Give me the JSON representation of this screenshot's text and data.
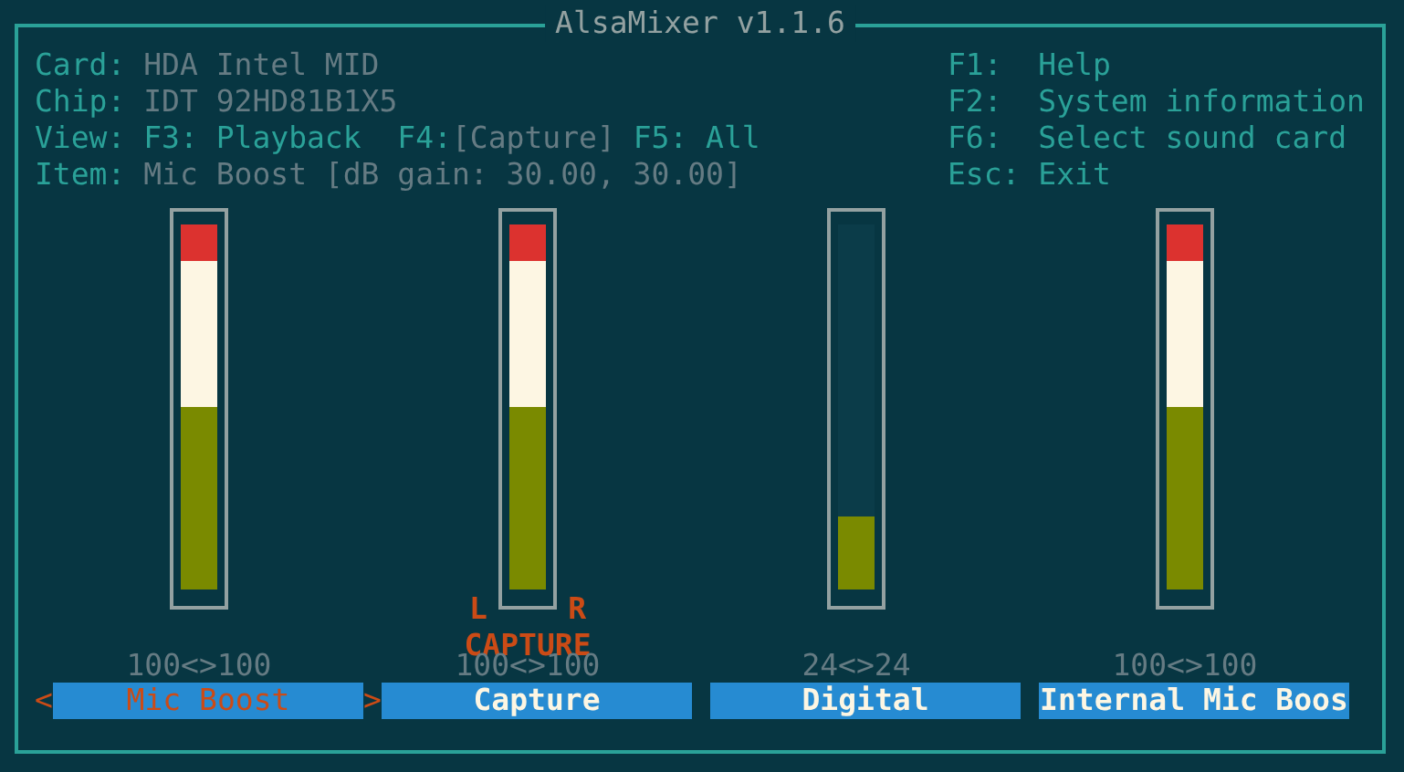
{
  "window": {
    "title": "AlsaMixer v1.1.6"
  },
  "info": [
    {
      "kind": "field",
      "label": "Card:",
      "value": "HDA Intel MID"
    },
    {
      "kind": "field",
      "label": "Chip:",
      "value": "IDT 92HD81B1X5"
    },
    {
      "kind": "views",
      "label": "View:",
      "views": [
        {
          "key": "F3:",
          "label": "Playback",
          "selected": false
        },
        {
          "key": "F4:",
          "label": "[Capture]",
          "selected": true
        },
        {
          "key": "F5:",
          "label": "All",
          "selected": false
        }
      ]
    },
    {
      "kind": "field",
      "label": "Item:",
      "value": "Mic Boost [dB gain: 30.00, 30.00]"
    }
  ],
  "help": [
    {
      "key": "F1:",
      "text": "Help"
    },
    {
      "key": "F2:",
      "text": "System information"
    },
    {
      "key": "F6:",
      "text": "Select sound card"
    },
    {
      "key": "Esc:",
      "text": "Exit"
    }
  ],
  "selection_markers": {
    "left": "<",
    "right": ">"
  },
  "channels": [
    {
      "name": "Mic Boost",
      "level": 1.0,
      "value": "100<>100",
      "selected": true
    },
    {
      "name": "Capture",
      "level": 1.0,
      "value": "100<>100",
      "selected": false,
      "capture": {
        "left": "L",
        "right": "R",
        "label": "CAPTURE"
      }
    },
    {
      "name": "Digital",
      "level": 0.2,
      "value": "24<>24",
      "selected": false
    },
    {
      "name": "Internal Mic Boos",
      "level": 1.0,
      "value": "100<>100",
      "selected": false
    }
  ]
}
